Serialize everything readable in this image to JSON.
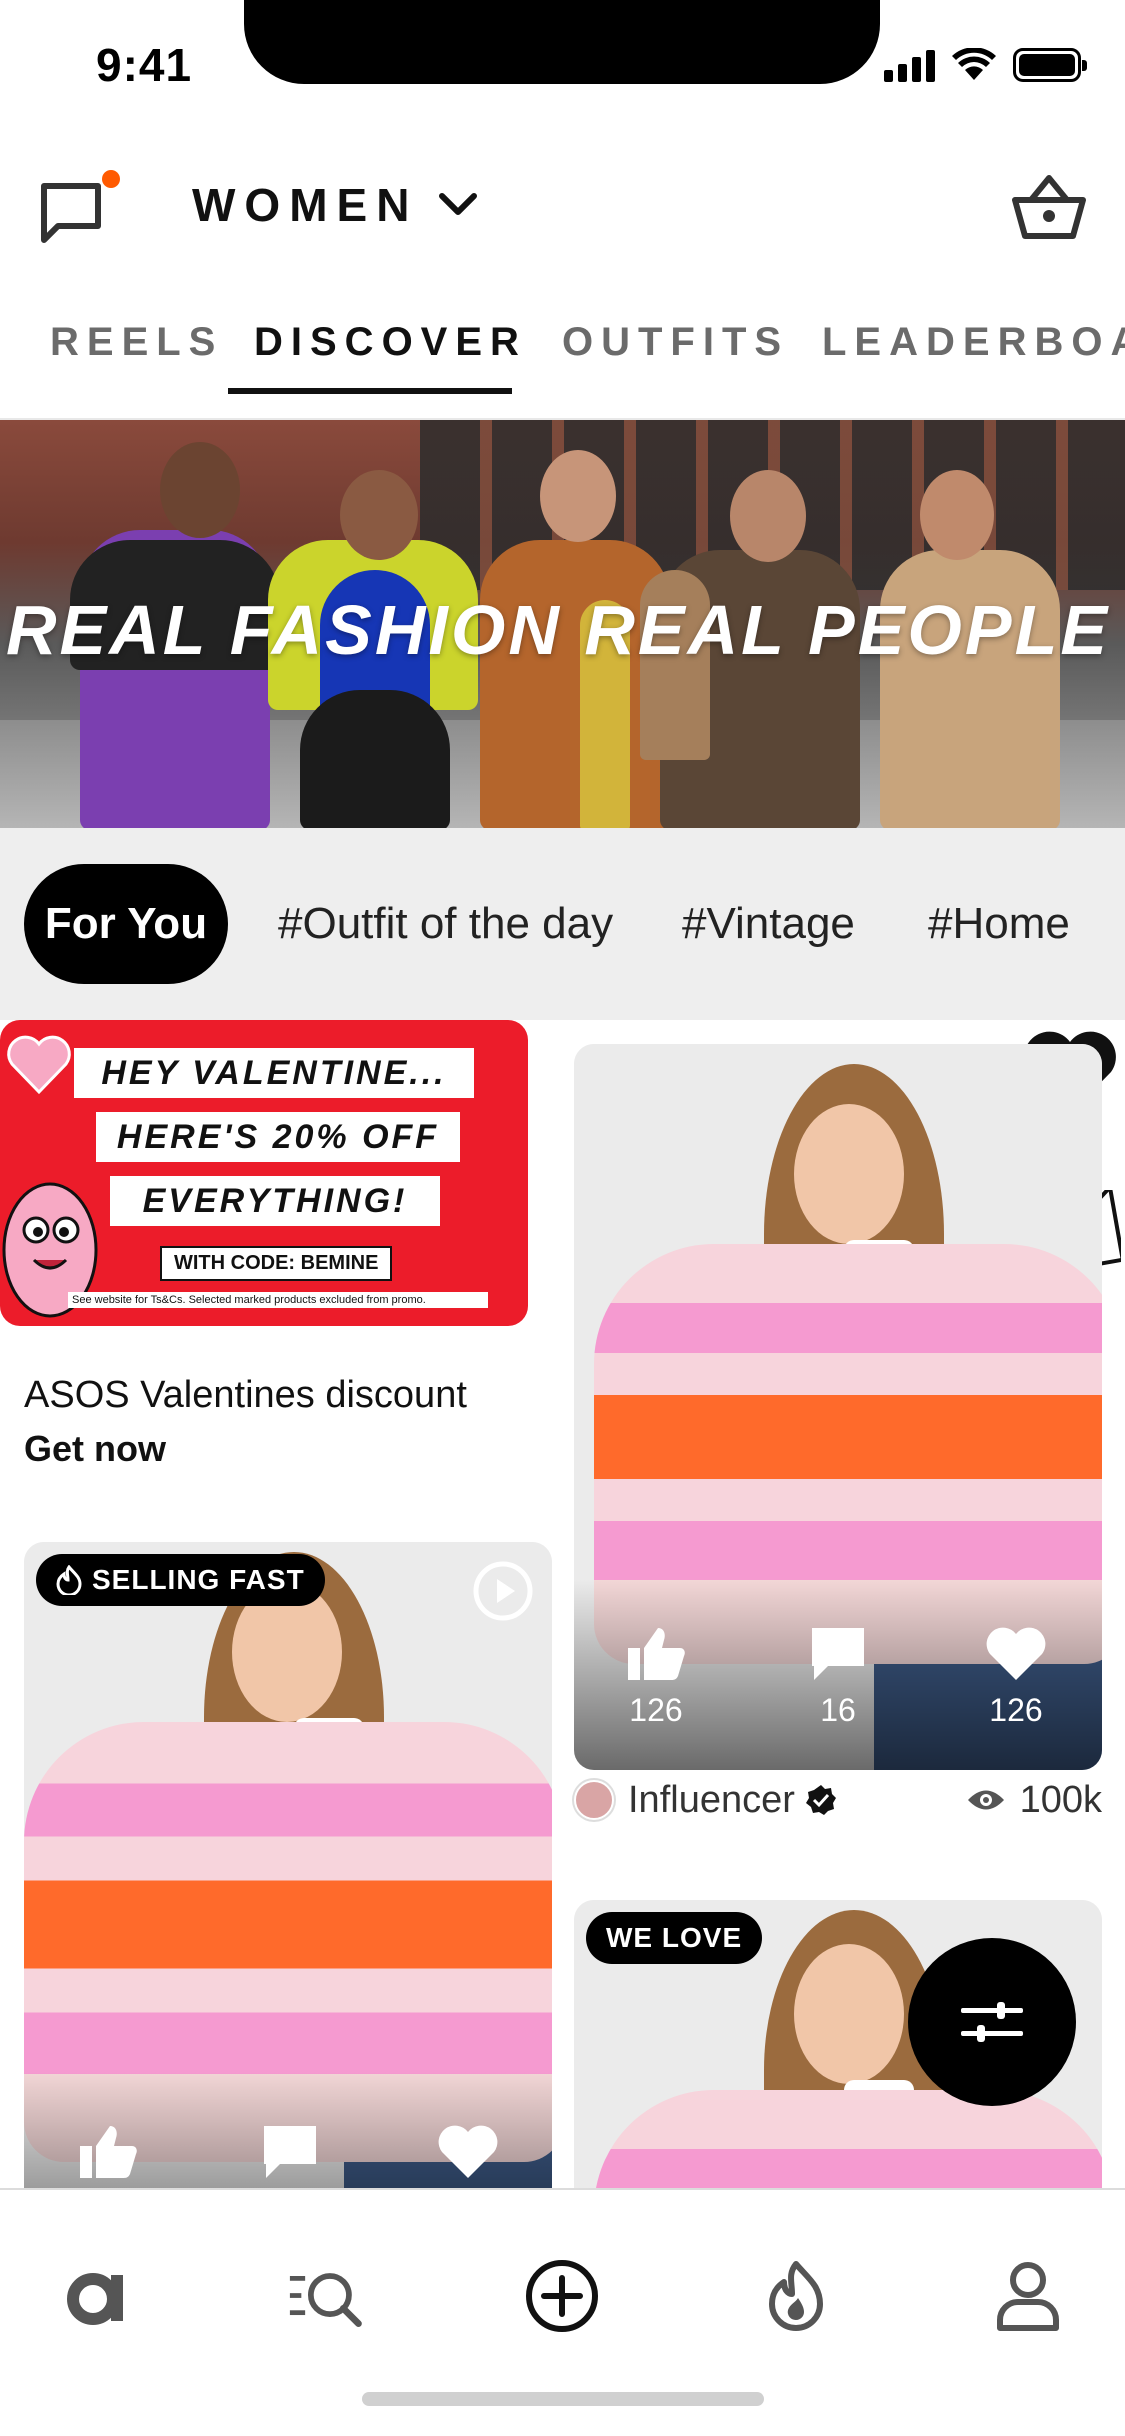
{
  "status_bar": {
    "time": "9:41"
  },
  "header": {
    "gender_label": "WOMEN",
    "icons": {
      "chat": "chat-bubble-icon",
      "dropdown": "chevron-down-icon",
      "basket": "basket-icon"
    },
    "colors": {
      "notification_dot": "#ff5a00"
    }
  },
  "tabs": [
    {
      "label": "REELS",
      "active": false
    },
    {
      "label": "DISCOVER",
      "active": true
    },
    {
      "label": "OUTFITS",
      "active": false
    },
    {
      "label": "LEADERBOARD",
      "active": false
    }
  ],
  "hero": {
    "title": "REAL FASHION REAL PEOPLE R"
  },
  "filters": [
    {
      "label": "For You",
      "active": true
    },
    {
      "label": "#Outfit of the day",
      "active": false
    },
    {
      "label": "#Vintage",
      "active": false
    },
    {
      "label": "#Home",
      "active": false
    }
  ],
  "promo": {
    "lines": [
      "HEY VALENTINE...",
      "HERE'S 20% OFF",
      "EVERYTHING!"
    ],
    "code": "WITH CODE: BEMINE",
    "fine_print": "See website for Ts&Cs. Selected marked products excluded from promo.",
    "title": "ASOS Valentines discount",
    "link": "Get now",
    "brand_color": "#ec1c2a"
  },
  "posts": [
    {
      "stats": {
        "likes": "126",
        "comments": "16",
        "hearts": "126"
      },
      "author": "Influencer",
      "verified": true,
      "views": "100k"
    },
    {
      "badge": "SELLING FAST",
      "badge_icon": "flame-icon",
      "has_video": true
    },
    {
      "badge": "WE LOVE"
    }
  ],
  "fab": {
    "icon": "sliders-icon"
  },
  "bottom_nav": [
    {
      "name": "home",
      "icon": "asos-a-icon"
    },
    {
      "name": "search",
      "icon": "search-list-icon"
    },
    {
      "name": "create",
      "icon": "plus-circle-icon"
    },
    {
      "name": "trending",
      "icon": "flame-icon"
    },
    {
      "name": "profile",
      "icon": "person-icon"
    }
  ]
}
